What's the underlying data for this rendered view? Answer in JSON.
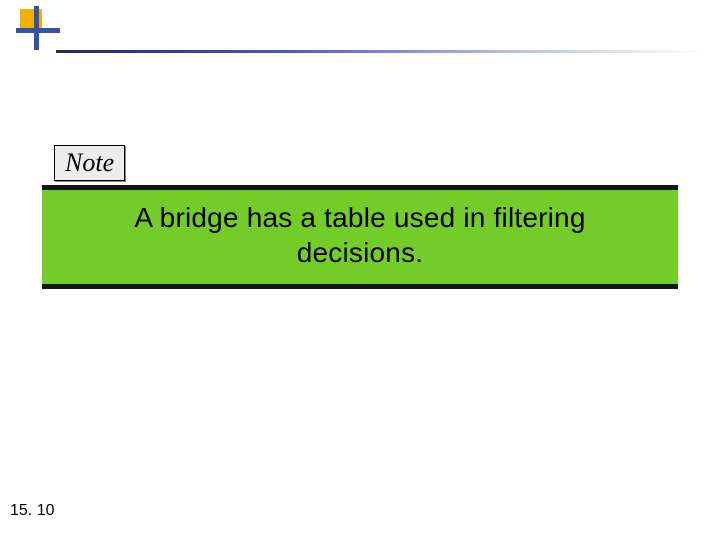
{
  "header": {
    "accent_square_color": "#f0b000",
    "accent_cross_color": "#3a4fa6"
  },
  "note": {
    "label": "Note"
  },
  "highlight": {
    "text": "A bridge has a table used in filtering decisions.",
    "background": "#73cc28"
  },
  "footer": {
    "page_number": "15. 10"
  }
}
